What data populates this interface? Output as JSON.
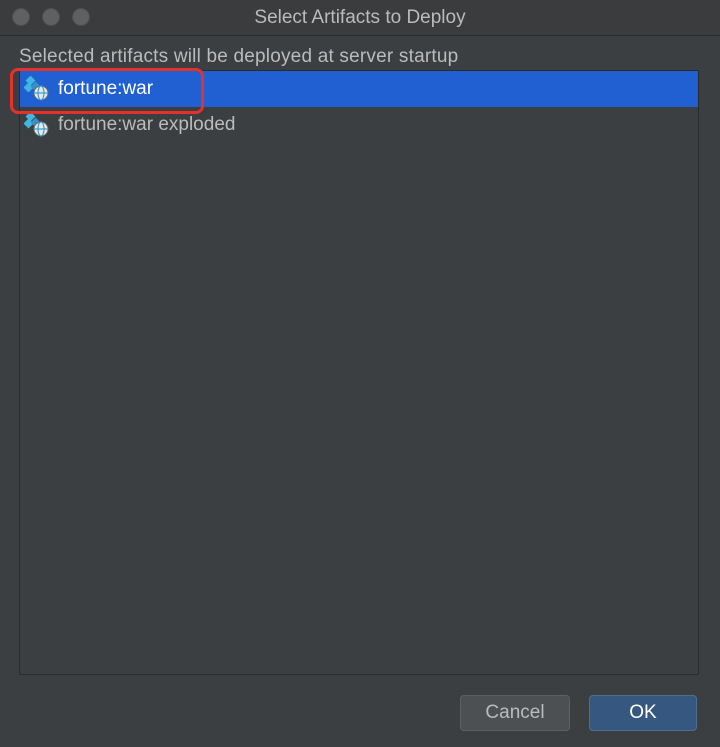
{
  "window": {
    "title": "Select Artifacts to Deploy"
  },
  "subtitle": "Selected artifacts will be deployed at server startup",
  "artifacts": [
    {
      "label": "fortune:war",
      "selected": true,
      "icon": "artifact-web-icon"
    },
    {
      "label": "fortune:war exploded",
      "selected": false,
      "icon": "artifact-web-icon"
    }
  ],
  "buttons": {
    "cancel": "Cancel",
    "ok": "OK"
  },
  "colors": {
    "background": "#3c3f41",
    "selection": "#2160d3",
    "annotation": "#e5312a",
    "ok_button": "#365880"
  }
}
